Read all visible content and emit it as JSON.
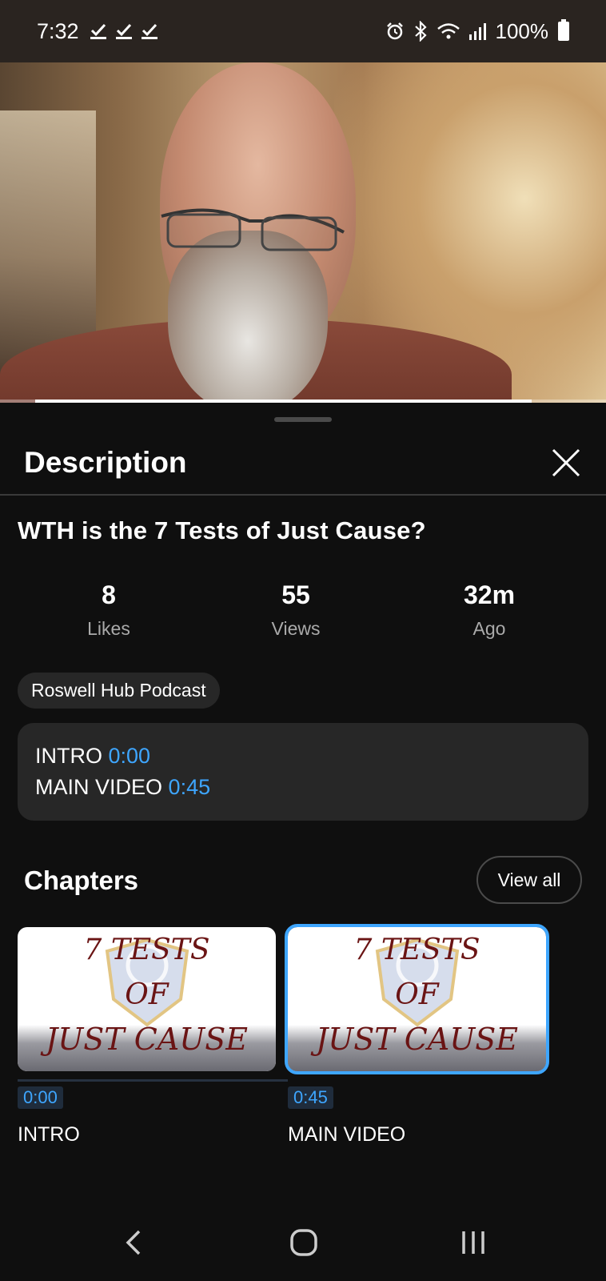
{
  "status_bar": {
    "time": "7:32",
    "battery": "100%",
    "icons": [
      "check-icon",
      "check-icon",
      "check-icon",
      "alarm-icon",
      "bluetooth-icon",
      "wifi-icon",
      "signal-icon",
      "battery-icon"
    ]
  },
  "video": {
    "progress_fraction": 0.87
  },
  "sheet": {
    "title": "Description",
    "video_title": "WTH is the 7 Tests of Just Cause?",
    "stats": [
      {
        "value": "8",
        "label": "Likes"
      },
      {
        "value": "55",
        "label": "Views"
      },
      {
        "value": "32m",
        "label": "Ago"
      }
    ],
    "channel_tag": "Roswell Hub Podcast",
    "description_lines": [
      {
        "text": "INTRO",
        "timestamp": "0:00"
      },
      {
        "text": "MAIN VIDEO",
        "timestamp": "0:45"
      }
    ],
    "chapters_title": "Chapters",
    "view_all_label": "View all",
    "chapters": [
      {
        "time": "0:00",
        "label": "INTRO",
        "thumb_lines": [
          "7 TESTS",
          "OF",
          "JUST CAUSE"
        ],
        "selected": false
      },
      {
        "time": "0:45",
        "label": "MAIN VIDEO",
        "thumb_lines": [
          "7 TESTS",
          "OF",
          "JUST CAUSE"
        ],
        "selected": true
      }
    ]
  },
  "colors": {
    "background": "#0f0f0f",
    "card": "#272727",
    "accent_blue": "#3ea6ff",
    "thumb_text": "#6a1414"
  }
}
